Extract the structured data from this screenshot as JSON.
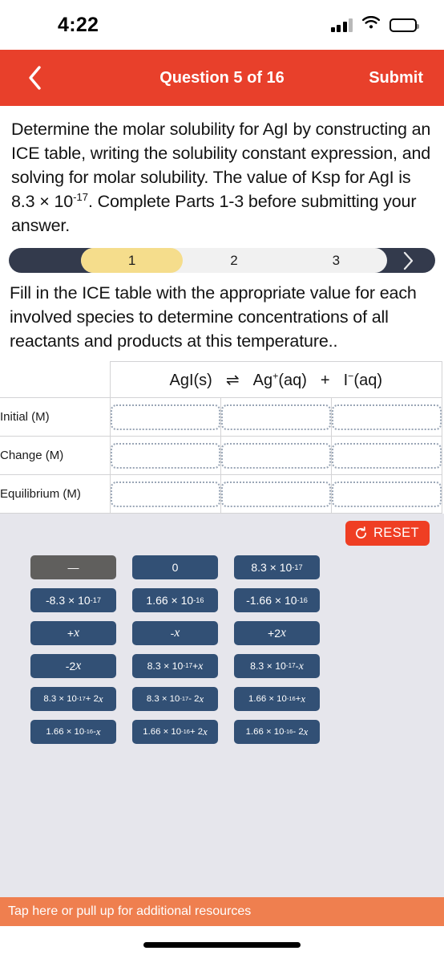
{
  "status_bar": {
    "time": "4:22",
    "signal_icon": "cellular-signal-icon",
    "wifi_icon": "wifi-icon",
    "battery_icon": "battery-icon"
  },
  "app_bar": {
    "back_icon": "chevron-left-icon",
    "title": "Question 5 of 16",
    "submit_label": "Submit",
    "background_color": "#e8402b"
  },
  "question": {
    "text_a": "Determine the molar solubility for AgI by constructing an ICE table, writing the solubility constant expression, and solving for molar solubility. The value of Ksp for AgI is 8.3 × 10",
    "exponent": "-17",
    "text_b": ". Complete Parts 1-3 before submitting your answer."
  },
  "stepper": {
    "steps": [
      {
        "label": "1",
        "active": true
      },
      {
        "label": "2",
        "active": false
      },
      {
        "label": "3",
        "active": false
      }
    ],
    "next_icon": "chevron-right-icon",
    "track_color": "#333a4c",
    "active_color": "#f5dd8c"
  },
  "instruction": {
    "text": "Fill in the ICE table with the appropriate value for each involved species to determine concentrations of all reactants and products at this temperature.."
  },
  "ice_table": {
    "equation": {
      "reactant": "AgI(s)",
      "equilibrium_arrow": "⇌",
      "product_1_base": "Ag",
      "product_1_charge": "+",
      "product_1_state": "(aq)",
      "plus": "+",
      "product_2_base": "I",
      "product_2_charge": "−",
      "product_2_state": "(aq)"
    },
    "row_labels": [
      "Initial (M)",
      "Change (M)",
      "Equilibrium (M)"
    ],
    "columns": 3,
    "cell_values": [
      [
        "",
        "",
        ""
      ],
      [
        "",
        "",
        ""
      ],
      [
        "",
        "",
        ""
      ]
    ]
  },
  "tray": {
    "reset_label": "RESET",
    "reset_icon": "reset-circular-arrow-icon",
    "reset_color": "#ef3e23",
    "tile_color": "#325075",
    "placeholder_color": "#605f5d",
    "background_color": "#e6e6ec",
    "tiles": [
      {
        "id": "t0",
        "html": "—",
        "kind": "placeholder",
        "size": ""
      },
      {
        "id": "t1",
        "html": "0",
        "kind": "tile",
        "size": ""
      },
      {
        "id": "t2",
        "html": "8.3 × 10<sup>-17</sup>",
        "kind": "tile",
        "size": ""
      },
      {
        "id": "t3",
        "html": "-8.3 × 10<sup>-17</sup>",
        "kind": "tile",
        "size": ""
      },
      {
        "id": "t4",
        "html": "1.66 × 10<sup>-16</sup>",
        "kind": "tile",
        "size": ""
      },
      {
        "id": "t5",
        "html": "-1.66 × 10<sup>-16</sup>",
        "kind": "tile",
        "size": ""
      },
      {
        "id": "t6",
        "html": "+<span class=\"it\">x</span>",
        "kind": "tile",
        "size": ""
      },
      {
        "id": "t7",
        "html": "-<span class=\"it\">x</span>",
        "kind": "tile",
        "size": ""
      },
      {
        "id": "t8",
        "html": "+2<span class=\"it\">x</span>",
        "kind": "tile",
        "size": ""
      },
      {
        "id": "t9",
        "html": "-2<span class=\"it\">x</span>",
        "kind": "tile",
        "size": ""
      },
      {
        "id": "t10",
        "html": "8.3 × 10<sup>-17</sup> + <span class=\"it\">x</span>",
        "kind": "tile",
        "size": "sm"
      },
      {
        "id": "t11",
        "html": "8.3 × 10<sup>-17</sup> - <span class=\"it\">x</span>",
        "kind": "tile",
        "size": "sm"
      },
      {
        "id": "t12",
        "html": "8.3 × 10<sup>-17</sup> + 2<span class=\"it\">x</span>",
        "kind": "tile",
        "size": "xs"
      },
      {
        "id": "t13",
        "html": "8.3 × 10<sup>-17</sup> - 2<span class=\"it\">x</span>",
        "kind": "tile",
        "size": "xs"
      },
      {
        "id": "t14",
        "html": "1.66 × 10<sup>-16</sup> + <span class=\"it\">x</span>",
        "kind": "tile",
        "size": "xs"
      },
      {
        "id": "t15",
        "html": "1.66 × 10<sup>-16</sup> - <span class=\"it\">x</span>",
        "kind": "tile",
        "size": "xs"
      },
      {
        "id": "t16",
        "html": "1.66 × 10<sup>-16</sup> + 2<span class=\"it\">x</span>",
        "kind": "tile",
        "size": "xs"
      },
      {
        "id": "t17",
        "html": "1.66 × 10<sup>-16</sup> - 2<span class=\"it\">x</span>",
        "kind": "tile",
        "size": "xs"
      }
    ]
  },
  "resources_bar": {
    "label": "Tap here or pull up for additional resources",
    "background_color": "#ef7f4f"
  }
}
